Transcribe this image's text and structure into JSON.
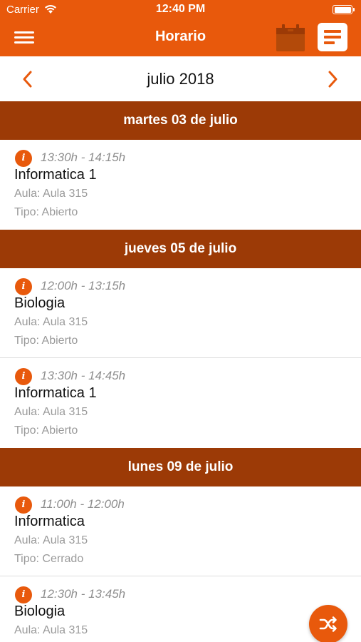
{
  "status_bar": {
    "carrier": "Carrier",
    "time": "12:40 PM",
    "wifi_icon": "wifi-icon",
    "battery_icon": "battery-icon"
  },
  "header": {
    "title": "Horario",
    "menu_icon": "hamburger-menu-icon",
    "calendar_icon": "calendar-icon",
    "list_icon": "list-view-icon"
  },
  "month_nav": {
    "label": "julio 2018",
    "prev_icon": "chevron-left-icon",
    "next_icon": "chevron-right-icon"
  },
  "days": [
    {
      "title": "martes 03 de julio",
      "classes": [
        {
          "time": "13:30h - 14:15h",
          "name": "Informatica 1",
          "room": "Aula: Aula 315",
          "type": "Tipo: Abierto"
        }
      ]
    },
    {
      "title": "jueves 05 de julio",
      "classes": [
        {
          "time": "12:00h - 13:15h",
          "name": "Biologia",
          "room": "Aula: Aula 315",
          "type": "Tipo: Abierto"
        },
        {
          "time": "13:30h - 14:45h",
          "name": "Informatica 1",
          "room": "Aula: Aula 315",
          "type": "Tipo: Abierto"
        }
      ]
    },
    {
      "title": "lunes 09 de julio",
      "classes": [
        {
          "time": "11:00h - 12:00h",
          "name": "Informatica",
          "room": "Aula: Aula 315",
          "type": "Tipo: Cerrado"
        },
        {
          "time": "12:30h - 13:45h",
          "name": "Biologia",
          "room": "Aula: Aula 315",
          "type": ""
        }
      ]
    }
  ],
  "info_icon": {
    "name": "info-icon",
    "glyph": "i"
  },
  "fab": {
    "icon": "shuffle-icon"
  },
  "colors": {
    "primary": "#e8590c",
    "day_header": "#9c3a06",
    "text_secondary": "#9a9a9a"
  }
}
